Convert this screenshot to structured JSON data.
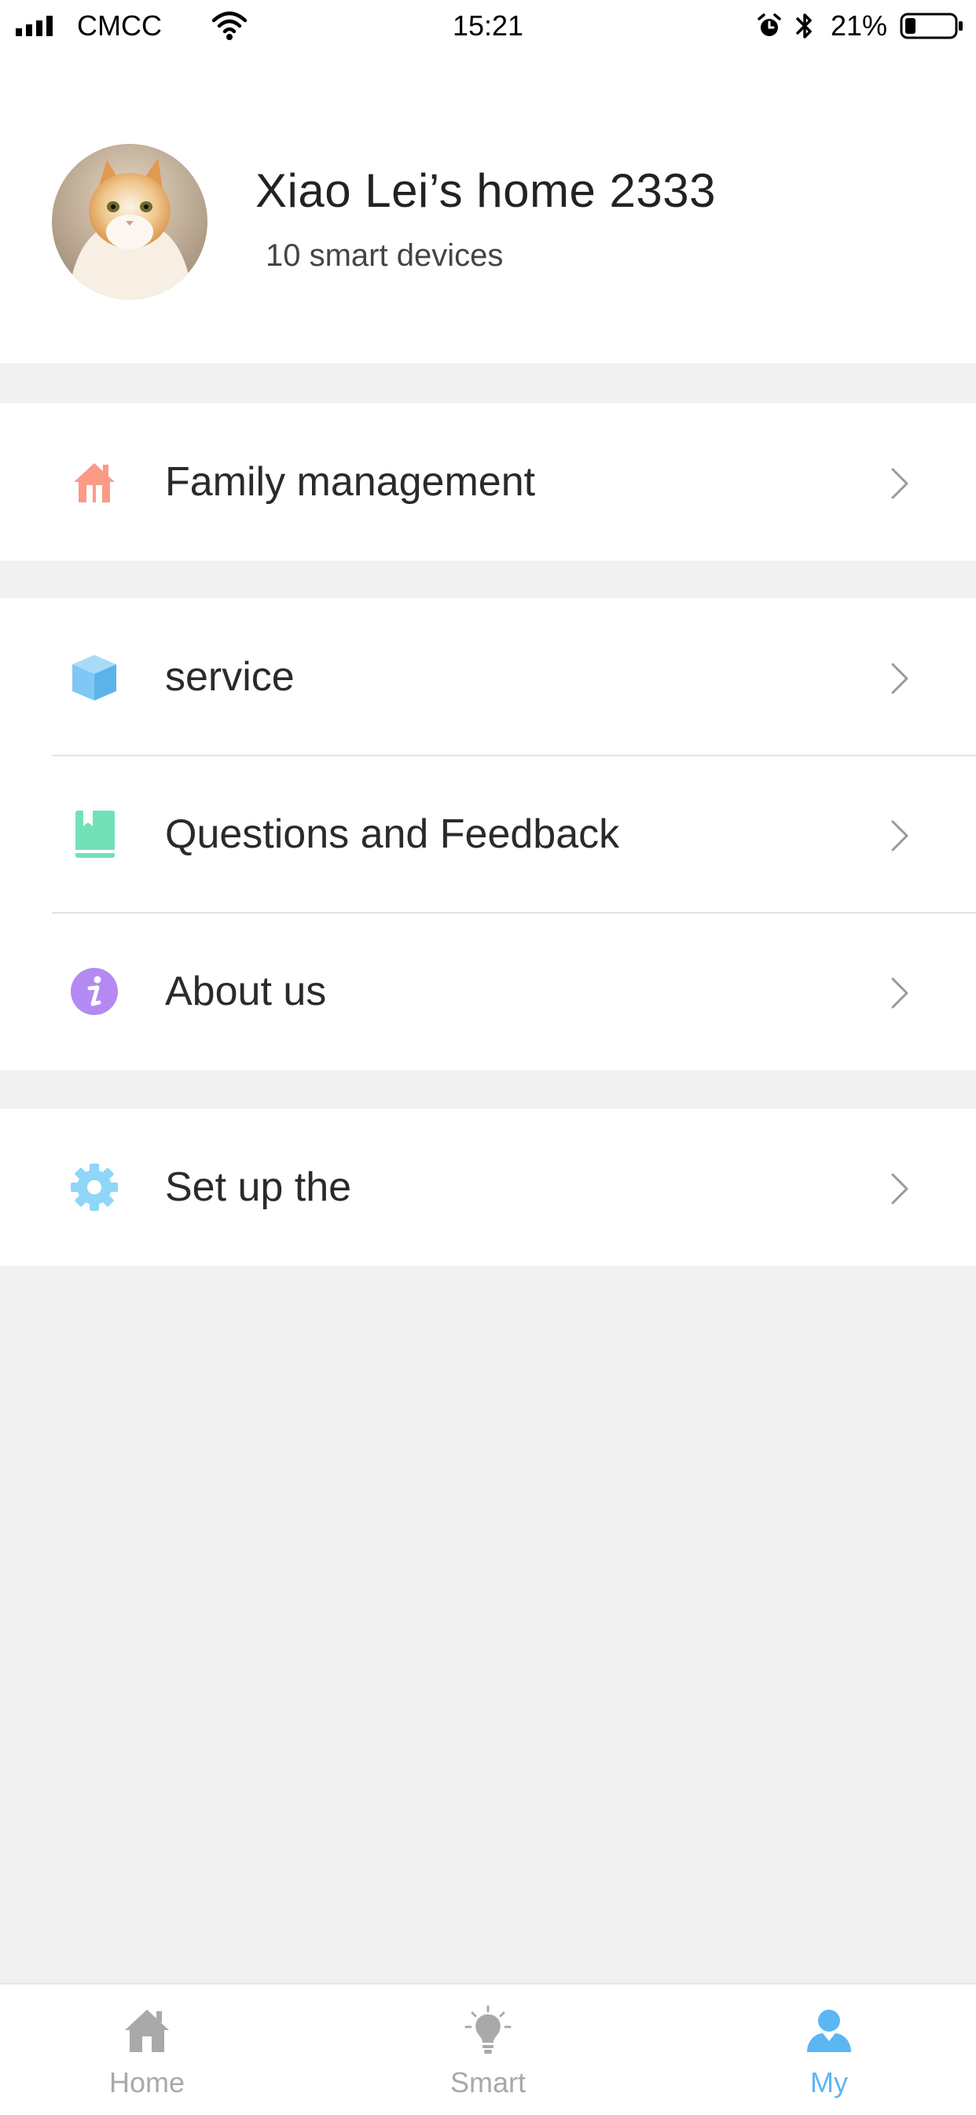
{
  "status_bar": {
    "carrier": "CMCC",
    "time": "15:21",
    "battery_percent": "21%",
    "battery_level": 0.21,
    "icons": [
      "signal-icon",
      "wifi-icon",
      "alarm-icon",
      "bluetooth-icon",
      "battery-icon"
    ]
  },
  "profile": {
    "name": "Xiao Lei’s home 2333",
    "subtitle": "10 smart devices",
    "avatar": "cat-avatar"
  },
  "menu": {
    "family": {
      "label": "Family management",
      "icon": "house-icon",
      "color": "#fb9a86"
    },
    "service": {
      "label": "service",
      "icon": "cube-icon",
      "color": "#7fc7f4"
    },
    "feedback": {
      "label": "Questions and Feedback",
      "icon": "book-icon",
      "color": "#73e1b8"
    },
    "about": {
      "label": "About us",
      "icon": "info-icon",
      "color": "#b48af2"
    },
    "setup": {
      "label": "Set up the",
      "icon": "gear-icon",
      "color": "#8fd6f8"
    }
  },
  "tab_bar": {
    "home": "Home",
    "smart": "Smart",
    "my": "My",
    "active": "My",
    "active_color": "#5cb6f2",
    "inactive_color": "#a9a9a9"
  }
}
